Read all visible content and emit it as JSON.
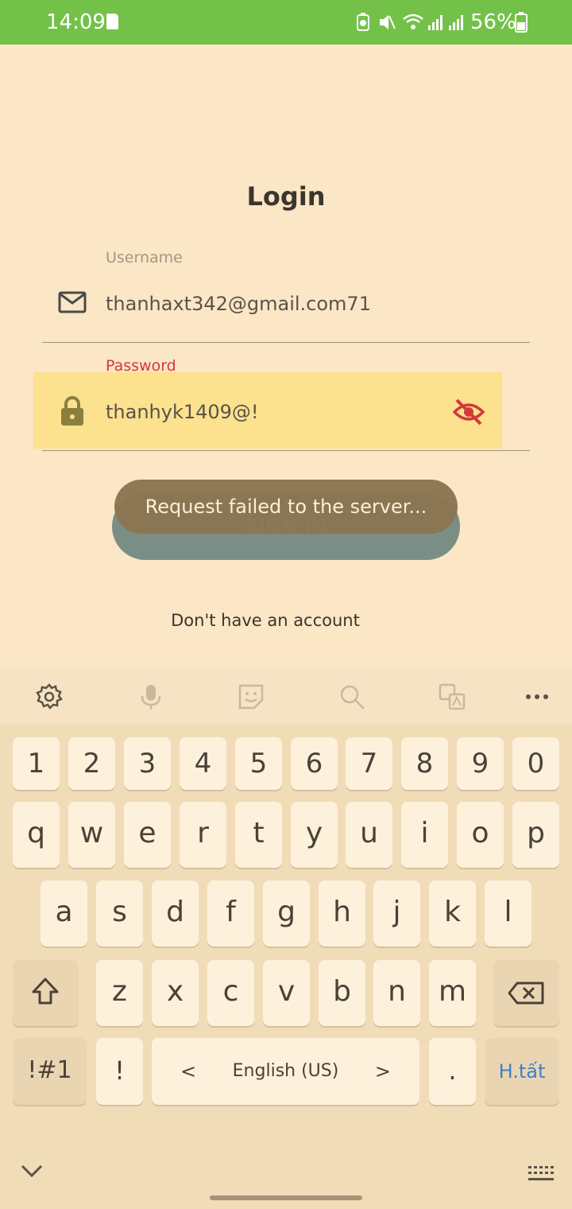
{
  "status": {
    "time": "14:09",
    "battery": "56%"
  },
  "login": {
    "title": "Login",
    "username_label": "Username",
    "username_value": "thanhaxt342@gmail.com71",
    "password_label": "Password",
    "password_value": "thanhyk1409@!",
    "signin_label": "SIGN IN",
    "toast": "Request failed to the server...",
    "register_link": "Don't have an account"
  },
  "keyboard": {
    "numbers": [
      "1",
      "2",
      "3",
      "4",
      "5",
      "6",
      "7",
      "8",
      "9",
      "0"
    ],
    "row1": [
      "q",
      "w",
      "e",
      "r",
      "t",
      "y",
      "u",
      "i",
      "o",
      "p"
    ],
    "row2": [
      "a",
      "s",
      "d",
      "f",
      "g",
      "h",
      "j",
      "k",
      "l"
    ],
    "row3": [
      "z",
      "x",
      "c",
      "v",
      "b",
      "n",
      "m"
    ],
    "symbols_label": "!#1",
    "exclaim_label": "!",
    "language_label": "English (US)",
    "left_arrow": "<",
    "right_arrow": ">",
    "period_label": ".",
    "done_label": "H.tất"
  },
  "colors": {
    "status_bar": "#74c14a",
    "background": "#fbe6c5",
    "error_label": "#d13a3a",
    "password_highlight": "#fce18f",
    "signin_button": "#7a8e86",
    "toast_bg": "#8b7651",
    "done_key": "#3f7fc7"
  },
  "icons": [
    "sd-card-icon",
    "battery-saver-icon",
    "mute-icon",
    "wifi-icon",
    "signal-icon",
    "battery-icon",
    "mail-icon",
    "lock-icon",
    "eye-off-icon",
    "settings-icon",
    "mic-icon",
    "sticker-icon",
    "search-icon",
    "translate-icon",
    "more-icon",
    "shift-icon",
    "backspace-icon",
    "collapse-icon",
    "keyboard-icon"
  ]
}
